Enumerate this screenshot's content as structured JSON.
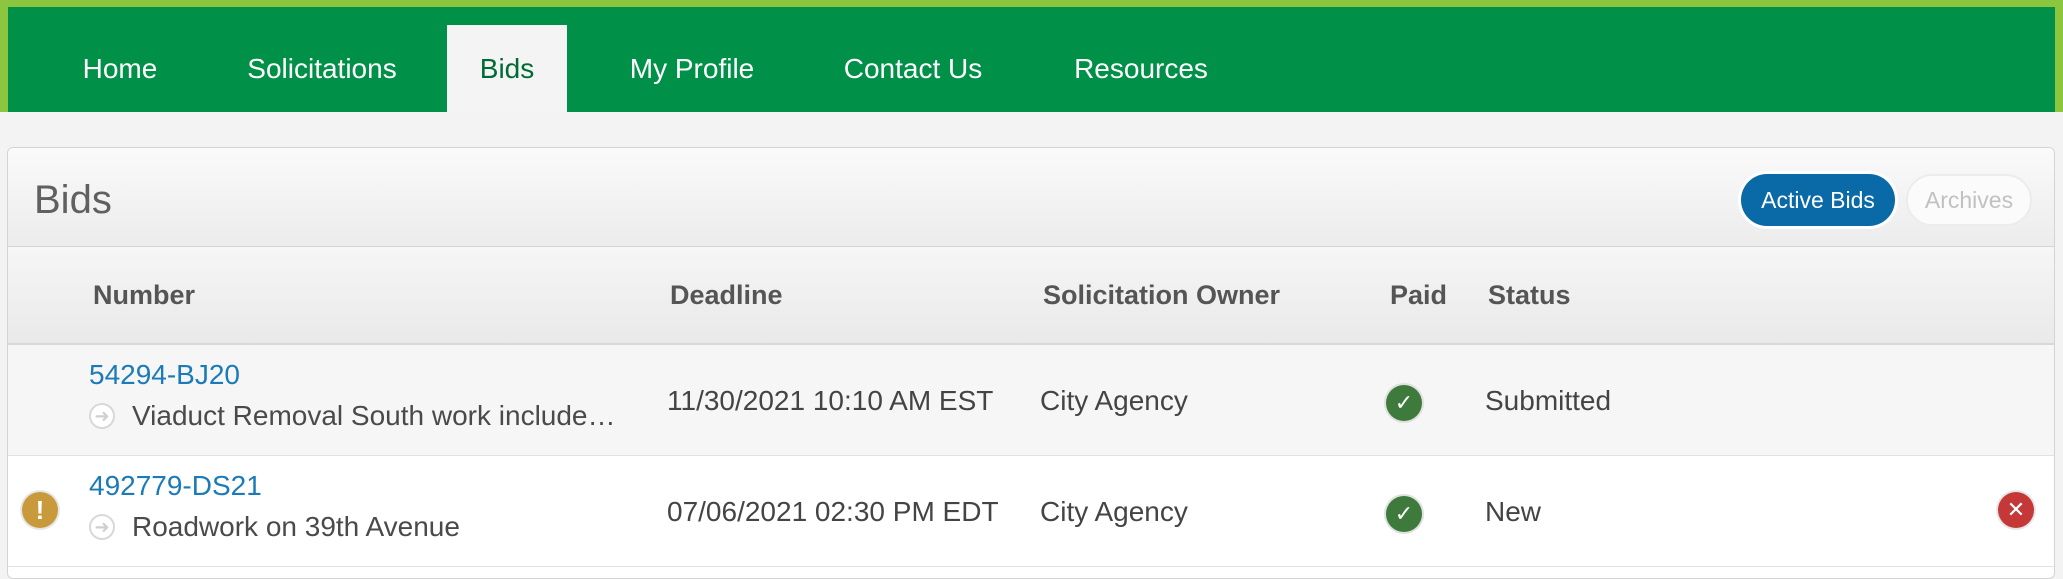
{
  "nav": {
    "items": [
      {
        "label": "Home"
      },
      {
        "label": "Solicitations"
      },
      {
        "label": "Bids"
      },
      {
        "label": "My Profile"
      },
      {
        "label": "Contact Us"
      },
      {
        "label": "Resources"
      }
    ],
    "active": "Bids"
  },
  "panel": {
    "title": "Bids",
    "active_bids_label": "Active Bids",
    "archives_label": "Archives"
  },
  "table": {
    "columns": [
      "Number",
      "Deadline",
      "Solicitation Owner",
      "Paid",
      "Status"
    ],
    "rows": [
      {
        "number": "54294-BJ20",
        "description": "Viaduct Removal South work include…",
        "deadline": "11/30/2021 10:10 AM EST",
        "owner": "City Agency",
        "paid": true,
        "status": "Submitted",
        "warning": false,
        "removable": false
      },
      {
        "number": "492779-DS21",
        "description": "Roadwork on 39th Avenue",
        "deadline": "07/06/2021 02:30 PM EDT",
        "owner": "City Agency",
        "paid": true,
        "status": "New",
        "warning": true,
        "removable": true
      }
    ]
  },
  "icons": {
    "arrow": "arrow-right-icon",
    "paid": "check-circle-icon",
    "warning": "exclamation-circle-icon",
    "remove": "close-circle-icon"
  },
  "colors": {
    "nav_green": "#009048",
    "nav_border": "#8cc63f",
    "primary_blue": "#0a6aa8",
    "link_blue": "#1b7bb8",
    "paid_green": "#3d7a3b",
    "warning_gold": "#c89a3c",
    "remove_red": "#c43838"
  }
}
